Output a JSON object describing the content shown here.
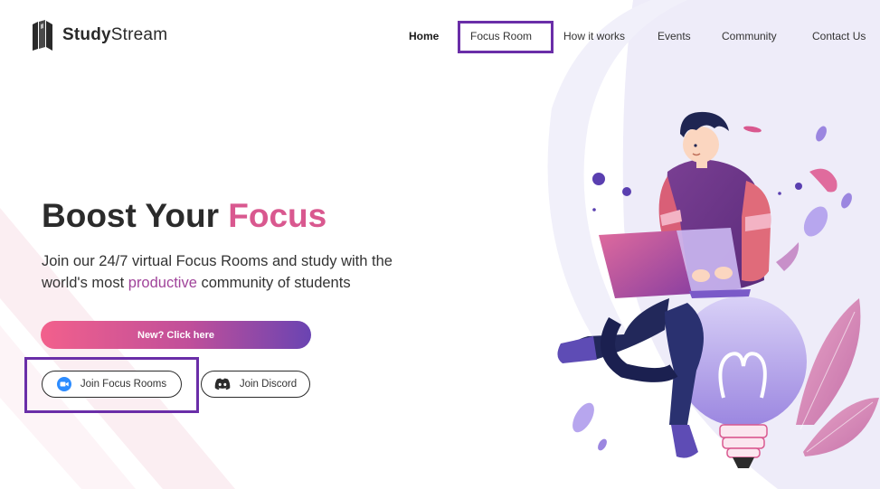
{
  "brand": {
    "name_bold": "Study",
    "name_light": "Stream"
  },
  "nav": {
    "items": [
      {
        "label": "Home",
        "active": true
      },
      {
        "label": "Focus Room"
      },
      {
        "label": "How it works"
      },
      {
        "label": "Events"
      },
      {
        "label": "Community"
      },
      {
        "label": "Contact Us"
      }
    ]
  },
  "hero": {
    "title_main": "Boost Your ",
    "title_accent": "Focus",
    "subtitle_pre": "Join our 24/7 virtual Focus Rooms and study with the world's most ",
    "subtitle_accent": "productive",
    "subtitle_post": " community of students"
  },
  "buttons": {
    "cta": "New? Click here",
    "join_focus": "Join Focus Rooms",
    "join_discord": "Join Discord"
  },
  "icons": {
    "logo": "books-logo-icon",
    "zoom": "video-camera-icon",
    "discord": "discord-icon",
    "illustration": "student-on-lightbulb-illustration"
  },
  "colors": {
    "accent_pink": "#d9588f",
    "accent_purple": "#a0449a",
    "highlight_box": "#6a2ea8",
    "gradient": [
      "#f2608c",
      "#6a44b2"
    ]
  }
}
